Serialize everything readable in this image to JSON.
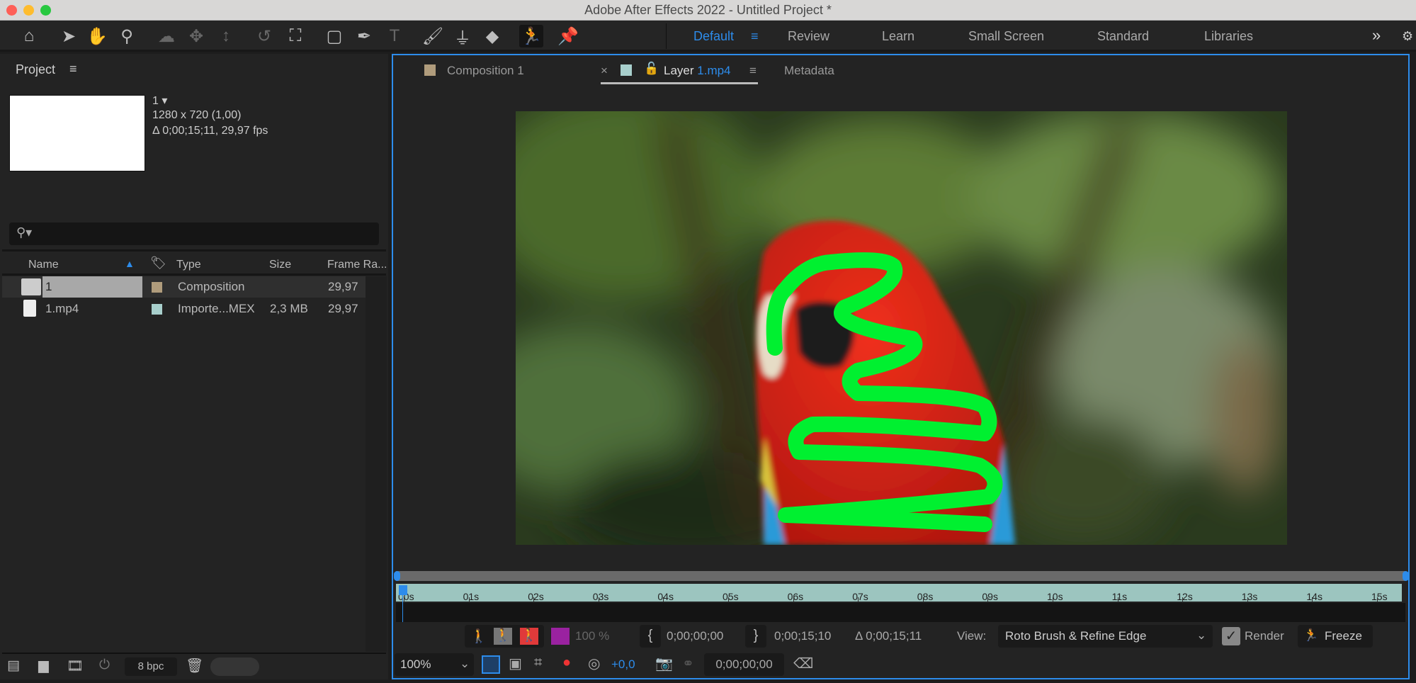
{
  "window": {
    "title": "Adobe After Effects 2022 - Untitled Project *"
  },
  "toolbar": {
    "tools": [
      "home-icon",
      "selection-icon",
      "hand-icon",
      "zoom-icon",
      "orbit-icon",
      "pan-icon",
      "dolly-icon",
      "rotate-icon",
      "anchor-icon",
      "rectangle-icon",
      "pen-icon",
      "type-icon",
      "brush-icon",
      "clone-stamp-icon",
      "eraser-icon",
      "roto-brush-icon",
      "puppet-pin-icon"
    ],
    "workspaces": [
      "Default",
      "Review",
      "Learn",
      "Small Screen",
      "Standard",
      "Libraries"
    ],
    "active_workspace": "Default",
    "more": "»",
    "accent": "#2d8ceb"
  },
  "project": {
    "title": "Project",
    "menu": "≡",
    "selected_name": "1 ▾",
    "resolution": "1280 x 720 (1,00)",
    "duration": "Δ 0;00;15;11, 29,97 fps",
    "search_placeholder": "",
    "columns": [
      "Name",
      "Type",
      "Size",
      "Frame Ra..."
    ],
    "rows": [
      {
        "name": "1",
        "label_color": "#b09c7c",
        "type": "Composition",
        "size": "",
        "fps": "29,97"
      },
      {
        "name": "1.mp4",
        "label_color": "#a8cfcc",
        "type": "Importe...MEX",
        "size": "2,3 MB",
        "fps": "29,97"
      }
    ],
    "bpc": "8 bpc"
  },
  "viewer": {
    "tabs": {
      "comp": "Composition 1",
      "close": "×",
      "layer_prefix": "Layer",
      "layer_name": "1.mp4",
      "menu": "≡",
      "metadata": "Metadata"
    },
    "ruler": [
      "00s",
      "01s",
      "02s",
      "03s",
      "04s",
      "05s",
      "06s",
      "07s",
      "08s",
      "09s",
      "10s",
      "11s",
      "12s",
      "13s",
      "14s",
      "15s"
    ],
    "opacity": "100 %",
    "in_time": "0;00;00;00",
    "out_time": "0;00;15;10",
    "duration": "Δ 0;00;15;11",
    "view_label": "View:",
    "view_value": "Roto Brush & Refine Edge",
    "render_label": "Render",
    "render_checked": true,
    "freeze_label": "Freeze",
    "zoom": "100%",
    "exposure": "+0,0",
    "current_time": "0;00;00;00",
    "stroke_color": "#00f030"
  }
}
